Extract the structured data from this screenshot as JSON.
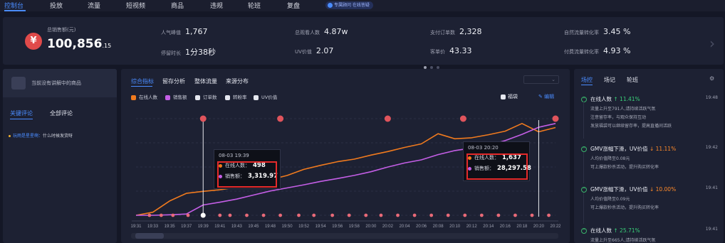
{
  "topnav": {
    "tabs": [
      "控制台",
      "投放",
      "流量",
      "短视频",
      "商品",
      "违规",
      "轮班",
      "复盘"
    ],
    "active": "控制台",
    "badge": "专属顾问 在线答疑"
  },
  "stats": {
    "total_label": "总销售额(元)",
    "total_main": "100,856",
    "total_decimal": ".15",
    "items": [
      {
        "label": "人气峰值",
        "value": "1,767"
      },
      {
        "label": "总观看人数",
        "value": "4.87w"
      },
      {
        "label": "支付订单数",
        "value": "2,328"
      },
      {
        "label": "自然流量转化率",
        "value": "3.45 %"
      },
      {
        "label": "停留时长",
        "value": "1分38秒"
      },
      {
        "label": "UV价值",
        "value": "2.07"
      },
      {
        "label": "客单价",
        "value": "43.33"
      },
      {
        "label": "付费流量转化率",
        "value": "4.93 %"
      }
    ]
  },
  "left": {
    "no_product": "当前没有讲解中的商品",
    "tabs": [
      "关键评论",
      "全部评论"
    ],
    "comment_user": "玩雨是星星啊：",
    "comment_text": "什么时候发货呀"
  },
  "center": {
    "tabs": [
      "综合指标",
      "留存分析",
      "整体流量",
      "来源分布"
    ],
    "legend": [
      "在线人数",
      "销售额",
      "订单数",
      "转粉率",
      "UV价值"
    ],
    "fudai": "福袋",
    "edit": "编辑",
    "tooltip1": {
      "time": "08-03 19:39",
      "online_label": "在线人数：",
      "online": "498",
      "sales_label": "销售额：",
      "sales": "3,319.97"
    },
    "tooltip2": {
      "time": "08-03 20:20",
      "online_label": "在线人数：",
      "online": "1,637",
      "sales_label": "销售额：",
      "sales": "28,297.58"
    }
  },
  "chart_data": {
    "type": "line",
    "x": [
      "19:31",
      "19:33",
      "19:35",
      "19:37",
      "19:39",
      "19:41",
      "19:43",
      "19:45",
      "19:48",
      "19:50",
      "19:52",
      "19:54",
      "19:56",
      "19:58",
      "20:00",
      "20:02",
      "20:04",
      "20:06",
      "20:08",
      "20:10",
      "20:12",
      "20:14",
      "20:16",
      "20:18",
      "20:20",
      "20:22"
    ],
    "series": [
      {
        "name": "在线人数",
        "color": "#f07a1e",
        "values": [
          0,
          60,
          280,
          430,
          470,
          500,
          550,
          620,
          700,
          780,
          900,
          980,
          1050,
          1100,
          1180,
          1250,
          1330,
          1400,
          1600,
          1500,
          1520,
          1580,
          1650,
          1800,
          1637,
          1720
        ]
      },
      {
        "name": "销售额",
        "color": "#c45ee6",
        "values": [
          0,
          0,
          150,
          400,
          3319.97,
          4200,
          5200,
          6500,
          7800,
          8800,
          9800,
          10900,
          11800,
          12800,
          14000,
          15500,
          16800,
          17800,
          19500,
          20800,
          21600,
          22500,
          24000,
          26000,
          28297.58,
          29500
        ]
      }
    ],
    "markers_label": "福袋"
  },
  "right": {
    "tabs": [
      "场控",
      "场记",
      "轮班"
    ],
    "events": [
      {
        "title": "在线人数",
        "change": "↑ 11.41%",
        "dir": "up",
        "time": "19:48",
        "lines": [
          "流量上升至791人,请持续活跃气氛",
          "注意留存率，与观众保持互动",
          "发放福袋可以继续留存率，提高直播间活跃"
        ]
      },
      {
        "title": "GMV涨幅下滑，UV价值",
        "change": "↓ 11.11%",
        "dir": "down",
        "time": "19:42",
        "lines": [
          "人均价值降至0.08元",
          "可上爆款秒杀活动，提升购买转化率"
        ]
      },
      {
        "title": "GMV涨幅下滑，UV价值",
        "change": "↓ 10.00%",
        "dir": "down",
        "time": "19:41",
        "lines": [
          "人均价值降至0.09元",
          "可上爆款秒杀活动，提升购买转化率"
        ]
      },
      {
        "title": "在线人数",
        "change": "↑ 25.71%",
        "dir": "up",
        "time": "19:41",
        "lines": [
          "流量上升至665人,请持续活跃气氛"
        ]
      }
    ]
  }
}
